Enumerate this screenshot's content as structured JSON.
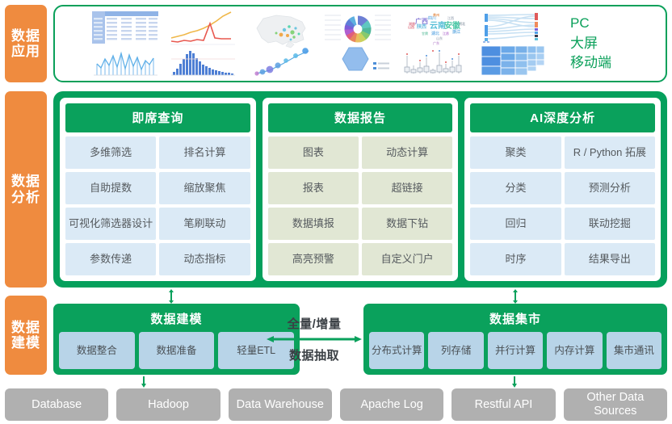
{
  "rails": [
    {
      "name": "data-application",
      "label": "数据应用"
    },
    {
      "name": "data-analysis",
      "label": "数据分析"
    },
    {
      "name": "data-modeling",
      "label": "数据建模"
    }
  ],
  "application": {
    "devices": [
      "PC",
      "大屏",
      "移动端"
    ],
    "thumbnails": [
      {
        "name": "table-and-line-chart-thumbnail",
        "kind": "table+line"
      },
      {
        "name": "multi-line-and-histogram-thumbnail",
        "kind": "line+bar"
      },
      {
        "name": "china-map-and-bubble-thumbnail",
        "kind": "map+bubble"
      },
      {
        "name": "donut-and-radar-thumbnail",
        "kind": "donut+radar"
      },
      {
        "name": "wordcloud-and-boxplot-thumbnail",
        "kind": "wordcloud+box"
      },
      {
        "name": "sankey-and-treemap-thumbnail",
        "kind": "sankey+treemap"
      }
    ],
    "wordcloud_terms": [
      "广西",
      "陕西",
      "云南",
      "安徽",
      "湖北",
      "广东",
      "上海",
      "浙江",
      "江苏",
      "福建",
      "河南",
      "山东"
    ]
  },
  "analysis": {
    "panels": [
      {
        "name": "ad-hoc-query",
        "title": "即席查询",
        "style": "blue",
        "items": [
          "多维筛选",
          "排名计算",
          "自助提数",
          "缩放聚焦",
          "可视化筛选器设计",
          "笔刷联动",
          "参数传递",
          "动态指标"
        ]
      },
      {
        "name": "data-report",
        "title": "数据报告",
        "style": "olive",
        "items": [
          "图表",
          "动态计算",
          "报表",
          "超链接",
          "数据填报",
          "数据下钻",
          "高亮预警",
          "自定义门户"
        ]
      },
      {
        "name": "ai-deep-analysis",
        "title": "AI深度分析",
        "style": "blue",
        "items": [
          "聚类",
          "R / Python 拓展",
          "分类",
          "预测分析",
          "回归",
          "联动挖掘",
          "时序",
          "结果导出"
        ]
      }
    ]
  },
  "modeling": {
    "model": {
      "name": "data-modeling-box",
      "title": "数据建模",
      "chips": [
        "数据整合",
        "数据准备",
        "轻量ETL"
      ]
    },
    "mart": {
      "name": "data-mart-box",
      "title": "数据集市",
      "chips": [
        "分布式计算",
        "列存储",
        "并行计算",
        "内存计算",
        "集市通讯"
      ]
    },
    "flow": {
      "top_label": "全量/增量",
      "bottom_label": "数据抽取"
    }
  },
  "sources": [
    "Database",
    "Hadoop",
    "Data Warehouse",
    "Apache Log",
    "Restful API",
    "Other Data Sources"
  ],
  "colors": {
    "rail_orange": "#ef8b3f",
    "green": "#0aa15c",
    "cell_blue": "#dbeaf6",
    "cell_olive": "#e1e7d4",
    "chip_blue": "#b8d4e8",
    "source_gray": "#b0b0b0"
  }
}
